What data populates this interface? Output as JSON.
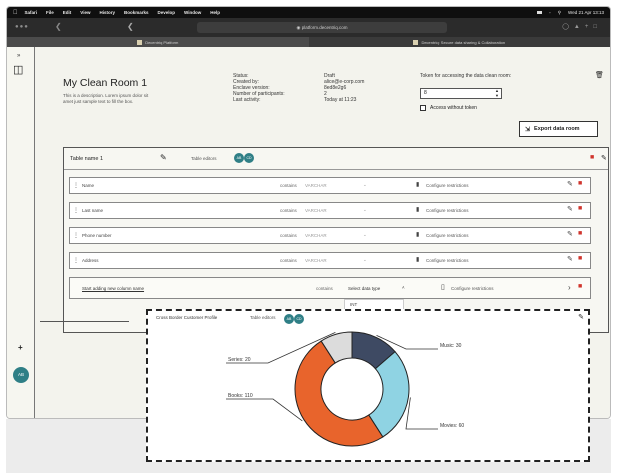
{
  "menubar": {
    "app": "Safari",
    "items": [
      "File",
      "Edit",
      "View",
      "History",
      "Bookmarks",
      "Develop",
      "Window",
      "Help"
    ],
    "clock": "Wed 21 Apr 13:13"
  },
  "browser": {
    "url": "platform.decentriq.com",
    "tabs": [
      "Decentriq Platform",
      "Decentriq: Secure data sharing & Collaboration"
    ]
  },
  "room": {
    "title": "My Clean Room 1",
    "description": "This is a description. Lorem ipsum dolor sit amet just sample text to fill the box.",
    "meta_labels": [
      "Status:",
      "Created by:",
      "Enclave version:",
      "Number of participants:",
      "Last activity:"
    ],
    "meta_values": [
      "Draft",
      "alice@e-corp.com",
      "8ed8e2g6",
      "2",
      "Today at 11:23"
    ],
    "token_label": "Token for accessing the data clean room:",
    "token_value": "8",
    "access_without_token": "Access without token",
    "export_label": "Export data room"
  },
  "table": {
    "name": "Table name 1",
    "editors_label": "Table editors",
    "editor_initials": [
      "AB",
      "CD"
    ],
    "rows": [
      {
        "name": "Name",
        "contains": "contains",
        "type": "VARCHAR",
        "config": "Configure restrictions"
      },
      {
        "name": "Last name",
        "contains": "contains",
        "type": "VARCHAR",
        "config": "Configure restrictions"
      },
      {
        "name": "Phone number",
        "contains": "contains",
        "type": "VARCHAR",
        "config": "Configure restrictions"
      },
      {
        "name": "Address",
        "contains": "contains",
        "type": "VARCHAR",
        "config": "Configure restrictions"
      }
    ],
    "new_row": {
      "placeholder": "Start adding new column name",
      "contains": "contains",
      "type_placeholder": "Select data type",
      "config": "Configure restrictions"
    },
    "dropdown_option": "INT"
  },
  "chart_overlay": {
    "title": "Cross Border Customer Profile",
    "editors_label": "Table editors"
  },
  "chart_data": {
    "type": "pie",
    "donut": true,
    "title": "",
    "categories": [
      "Music: 30",
      "Movies: 60",
      "Books: 110",
      "Series: 20"
    ],
    "values": [
      30,
      60,
      110,
      20
    ],
    "colors": [
      "#3e4a63",
      "#8fd3e3",
      "#e8642c",
      "#dcdcdc"
    ]
  }
}
